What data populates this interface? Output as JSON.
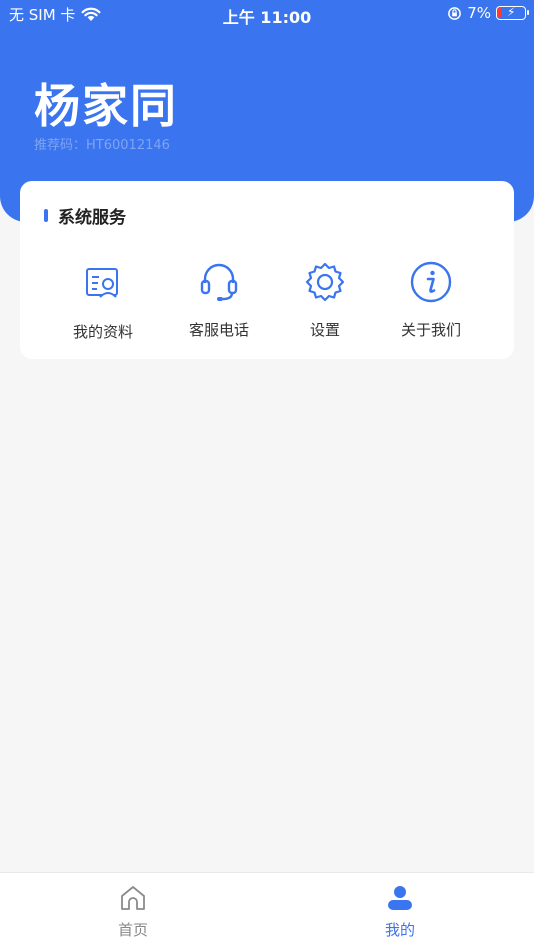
{
  "status_bar": {
    "carrier": "无 SIM 卡",
    "time": "上午 11:00",
    "battery": "7%"
  },
  "profile": {
    "name": "杨家同",
    "referral_label": "推荐码：",
    "referral_code": "HT60012146"
  },
  "system_services": {
    "title": "系统服务",
    "items": [
      {
        "label": "我的资料",
        "icon": "profile-card-icon"
      },
      {
        "label": "客服电话",
        "icon": "headset-icon"
      },
      {
        "label": "设置",
        "icon": "gear-icon"
      },
      {
        "label": "关于我们",
        "icon": "info-icon"
      }
    ]
  },
  "tabbar": {
    "items": [
      {
        "label": "首页",
        "icon": "home-icon",
        "active": false
      },
      {
        "label": "我的",
        "icon": "user-icon",
        "active": true
      }
    ]
  },
  "colors": {
    "accent": "#3a74ee",
    "tab_inactive": "#888888"
  }
}
